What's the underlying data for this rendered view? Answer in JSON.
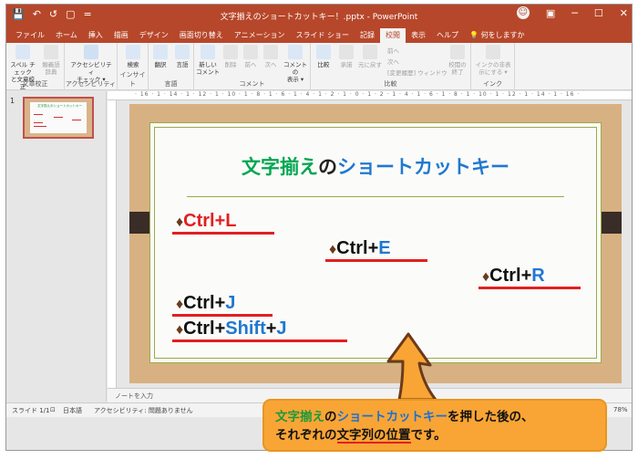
{
  "window": {
    "title": "文字揃えのショートカットキー！.pptx  -  PowerPoint",
    "accent": "#b7472a"
  },
  "qat": [
    "💾",
    "↶",
    "↺",
    "▢",
    "="
  ],
  "tabs": [
    "ファイル",
    "ホーム",
    "挿入",
    "描画",
    "デザイン",
    "画面切り替え",
    "アニメーション",
    "スライド ショー",
    "記録",
    "校閲",
    "表示",
    "ヘルプ"
  ],
  "active_tab": "校閲",
  "tell_me": "何をしますか",
  "ribbon": {
    "proofing": {
      "label": "文章校正",
      "b1": "スペル チェック\nと文章校正",
      "b2": "類義語\n辞典"
    },
    "accessibility": {
      "label": "アクセシビリティ",
      "b1": "アクセシビリティ\nチェック ▾"
    },
    "insights": {
      "label": "インサイト",
      "b1": "検索"
    },
    "language": {
      "label": "言語",
      "b1": "翻訳",
      "b2": "言語"
    },
    "comments": {
      "label": "コメント",
      "b1": "新しい\nコメント",
      "b2": "削除",
      "b3": "前へ",
      "b4": "次へ",
      "b5": "コメントの\n表示 ▾"
    },
    "compare": {
      "label": "比較",
      "b1": "比較",
      "b2": "承諾",
      "b3": "元に戻す",
      "s1": "前へ",
      "s2": "次へ",
      "s3": "[変更履歴] ウィンドウ",
      "b4": "校閲の\n終了"
    },
    "ink": {
      "label": "インク",
      "b1": "インクの非表\n示にする ▾"
    }
  },
  "thumbnail": {
    "number": "1",
    "title": "文字揃えのショートカットキー"
  },
  "ruler": "· 16 · 1 · 14 · 1 · 12 · 1 · 10 · 1 · 8 · 1 · 6 · 1 · 4 · 1 · 2 · 1 · 0 · 1 · 2 · 1 · 4 · 1 · 6 · 1 · 8 · 1 · 10 · 1 · 12 · 1 · 14 · 1 · 16 ·",
  "slide": {
    "title_part1": "文字揃え",
    "title_part2": "の",
    "title_part3": "ショートカットキー",
    "items": [
      {
        "prefix": "Ctrl+",
        "key": "L"
      },
      {
        "prefix": "Ctrl+",
        "key": "E"
      },
      {
        "prefix": "Ctrl+",
        "key": "R"
      },
      {
        "prefix": "Ctrl+",
        "key": "J"
      },
      {
        "prefix": "Ctrl+",
        "mid": "Shift",
        "plus": "+",
        "key": "J"
      }
    ],
    "diamond": "♦"
  },
  "notes_placeholder": "ノートを入力",
  "status": {
    "slide": "スライド 1/1",
    "lang": "日本語",
    "a11y": "アクセシビリティ: 問題ありません",
    "zoom": "78%"
  },
  "callout": {
    "p1": "文字揃え",
    "p2": "の",
    "p3": "ショートカットキー",
    "p4": "を押した後の、",
    "p5": "それぞれの",
    "p6": "文字列の位置",
    "p7": "です。"
  }
}
